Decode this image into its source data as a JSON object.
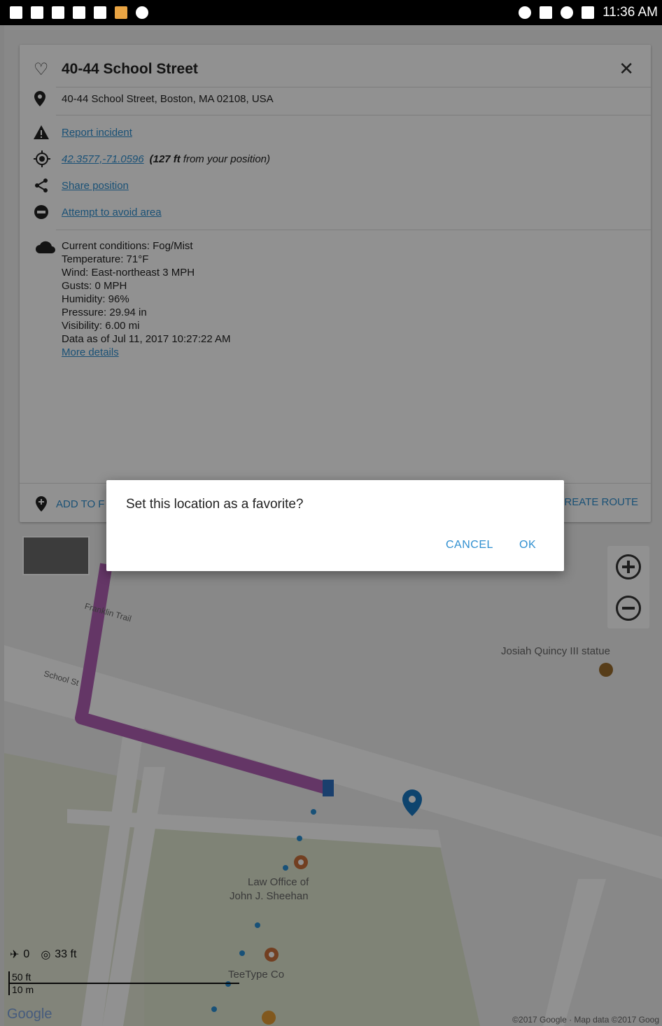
{
  "status_bar": {
    "time": "11:36 AM",
    "left_icons": [
      "notification-icon",
      "notification-icon",
      "notification-icon",
      "wrench-icon",
      "mail-icon",
      "photo-icon",
      "chat-icon"
    ],
    "right_icons": [
      "location-icon",
      "no-signal-icon",
      "wifi-icon",
      "battery-charging-icon"
    ]
  },
  "panel": {
    "title": "40-44 School Street",
    "address": "40-44 School Street, Boston, MA 02108, USA",
    "report_incident": "Report incident",
    "coords": "42.3577,-71.0596",
    "distance_bold": "(127 ft",
    "distance_rest": "from your position)",
    "share_position": "Share position",
    "avoid_area": "Attempt to avoid area",
    "weather": {
      "conditions": "Current conditions: Fog/Mist",
      "temperature": "Temperature: 71°F",
      "wind": "Wind: East-northeast 3 MPH",
      "gusts": "Gusts: 0 MPH",
      "humidity": "Humidity: 96%",
      "pressure": "Pressure: 29.94 in",
      "visibility": "Visibility: 6.00 mi",
      "data_as_of": "Data as of Jul 11, 2017 10:27:22 AM",
      "more_details": "More details"
    },
    "add_favorite": "ADD TO F",
    "create_route": "REATE ROUTE"
  },
  "map": {
    "street_franklin": "Franklin Trail",
    "street_school": "School St",
    "poi_quincy": "Josiah Quincy III statue",
    "poi_law_line1": "Law Office of",
    "poi_law_line2": "John J. Sheehan",
    "poi_teetype": "TeeType Co",
    "satellites": "0",
    "accuracy": "33 ft",
    "scale_ft": "50 ft",
    "scale_m": "10 m",
    "google": "Google",
    "copyright": "©2017 Google · Map data ©2017 Goog"
  },
  "dialog": {
    "message": "Set this location as a favorite?",
    "cancel": "CANCEL",
    "ok": "OK"
  },
  "colors": {
    "accent": "#2f8fd0",
    "route": "#b05fb3",
    "scrim": "rgba(0,0,0,0.43)"
  }
}
